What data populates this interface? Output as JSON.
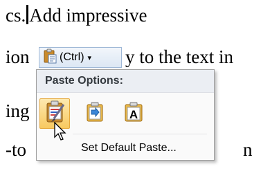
{
  "document": {
    "line1_before_caret": "cs.",
    "line1_after_caret": "Add impressive",
    "line2_left": "ion",
    "line2_right": "y to the text in",
    "line3_left": "ing",
    "line4_left": "-to",
    "line4_right": "n"
  },
  "smart_tag": {
    "label": "(Ctrl)",
    "icon": "clipboard-icon",
    "dropdown_icon": "chevron-down-icon"
  },
  "paste_menu": {
    "header": "Paste Options:",
    "options": [
      {
        "name": "keep-source-formatting",
        "icon": "clipboard-brush-icon",
        "selected": true
      },
      {
        "name": "merge-formatting",
        "icon": "clipboard-arrow-icon",
        "selected": false
      },
      {
        "name": "keep-text-only",
        "icon": "text-only-a-icon",
        "selected": false
      }
    ],
    "set_default_label": "Set Default Paste..."
  },
  "colors": {
    "menu_header_bg": "#ebeef3",
    "selected_option_bg": "#f8c95f",
    "selected_option_border": "#e6a93d",
    "smart_tag_border": "#9fb8d7"
  }
}
